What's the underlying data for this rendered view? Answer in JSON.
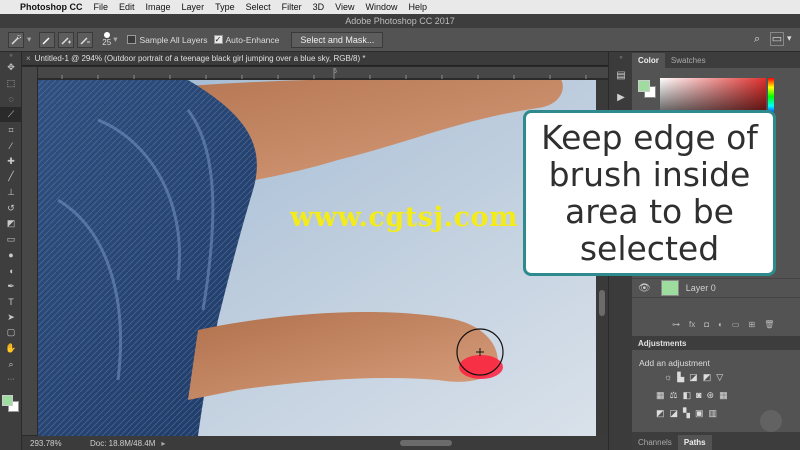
{
  "menu": {
    "apple_icon": "apple-icon",
    "app_name": "Photoshop CC",
    "items": [
      "File",
      "Edit",
      "Image",
      "Layer",
      "Type",
      "Select",
      "Filter",
      "3D",
      "View",
      "Window",
      "Help"
    ]
  },
  "window_title": "Adobe Photoshop CC 2017",
  "options_bar": {
    "brush_size": "25",
    "sample_all_layers": "Sample All Layers",
    "sample_all_layers_checked": false,
    "auto_enhance": "Auto-Enhance",
    "auto_enhance_checked": true,
    "select_and_mask": "Select and Mask..."
  },
  "document_tab": {
    "title": "Untitled-1 @ 294% (Outdoor portrait of a teenage black girl jumping over a blue sky, RGB/8) *",
    "close": "×"
  },
  "ruler": {
    "mark": "5"
  },
  "status": {
    "zoom": "293.78%",
    "doc": "Doc: 18.8M/48.4M"
  },
  "watermark": "www.cgtsj.com",
  "callout": "Keep edge of\nbrush inside\narea to be\nselected",
  "panels": {
    "color_tabs": [
      "Color",
      "Swatches"
    ],
    "layer_name": "Layer 0",
    "adjustments_title": "Adjustments",
    "add_adjustment": "Add an adjustment",
    "bottom_tabs": [
      "Channels",
      "Paths"
    ]
  },
  "colors": {
    "accent": "#2e8a8c",
    "foreground_swatch": "#9fdc9f",
    "background_swatch": "#ffffff",
    "brush_red": "#ff1f3d",
    "watermark_yellow": "#f3ec1a",
    "canvas_sky": "#b7c9dc"
  }
}
